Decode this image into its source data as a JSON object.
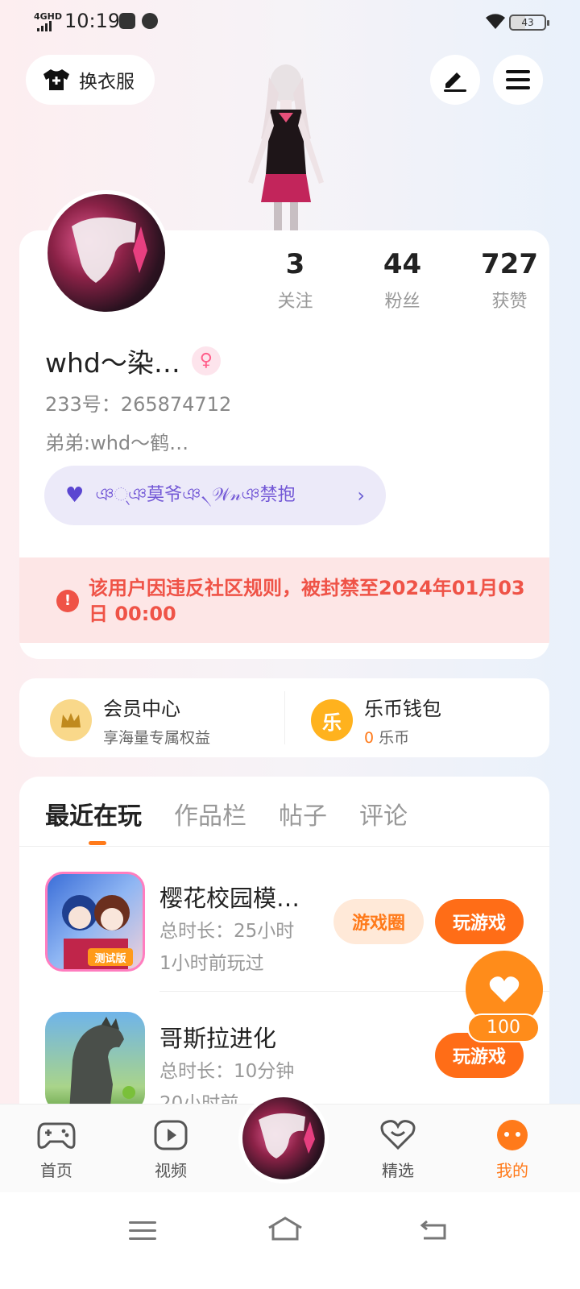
{
  "status_bar": {
    "network": "4GHD",
    "time": "10:19",
    "battery": "43"
  },
  "top_bar": {
    "outfit_label": "换衣服"
  },
  "profile": {
    "stats": [
      {
        "value": "3",
        "label": "关注"
      },
      {
        "value": "44",
        "label": "粉丝"
      },
      {
        "value": "727",
        "label": "获赞"
      }
    ],
    "username": "whd～染…",
    "gender_symbol": "♀",
    "uid": "233号：265874712",
    "bio": "弟弟:whd～鹤…",
    "tag_text": "ঞ୍ঞ莫爷ঞ৲𝒲𝓃ঞ禁抱",
    "tag_chevron": "›",
    "ban_notice": "该用户因违反社区规则，被封禁至2024年01月03日 00:00"
  },
  "wallet": {
    "member_title": "会员中心",
    "member_sub": "享海量专属权益",
    "coin_title": "乐币钱包",
    "coin_amount": "0",
    "coin_unit": "乐币",
    "coin_icon_text": "乐"
  },
  "tabs": [
    "最近在玩",
    "作品栏",
    "帖子",
    "评论"
  ],
  "games": [
    {
      "title": "樱花校园模…",
      "duration": "总时长：25小时",
      "last_played": "1小时前玩过",
      "circle_label": "游戏圈",
      "play_label": "玩游戏",
      "badge": "测试版"
    },
    {
      "title": "哥斯拉进化",
      "duration": "总时长：10分钟",
      "last_played": "20小时前",
      "play_label": "玩游戏"
    }
  ],
  "float_like": {
    "count": "100"
  },
  "bottom_nav": [
    {
      "label": "首页"
    },
    {
      "label": "视频"
    },
    {
      "label": "精选"
    },
    {
      "label": "我的"
    }
  ],
  "colors": {
    "accent": "#ff7a1a",
    "ban_text": "#ef5347",
    "ban_bg": "#fde6e6",
    "tag_bg": "#eceaf9"
  }
}
